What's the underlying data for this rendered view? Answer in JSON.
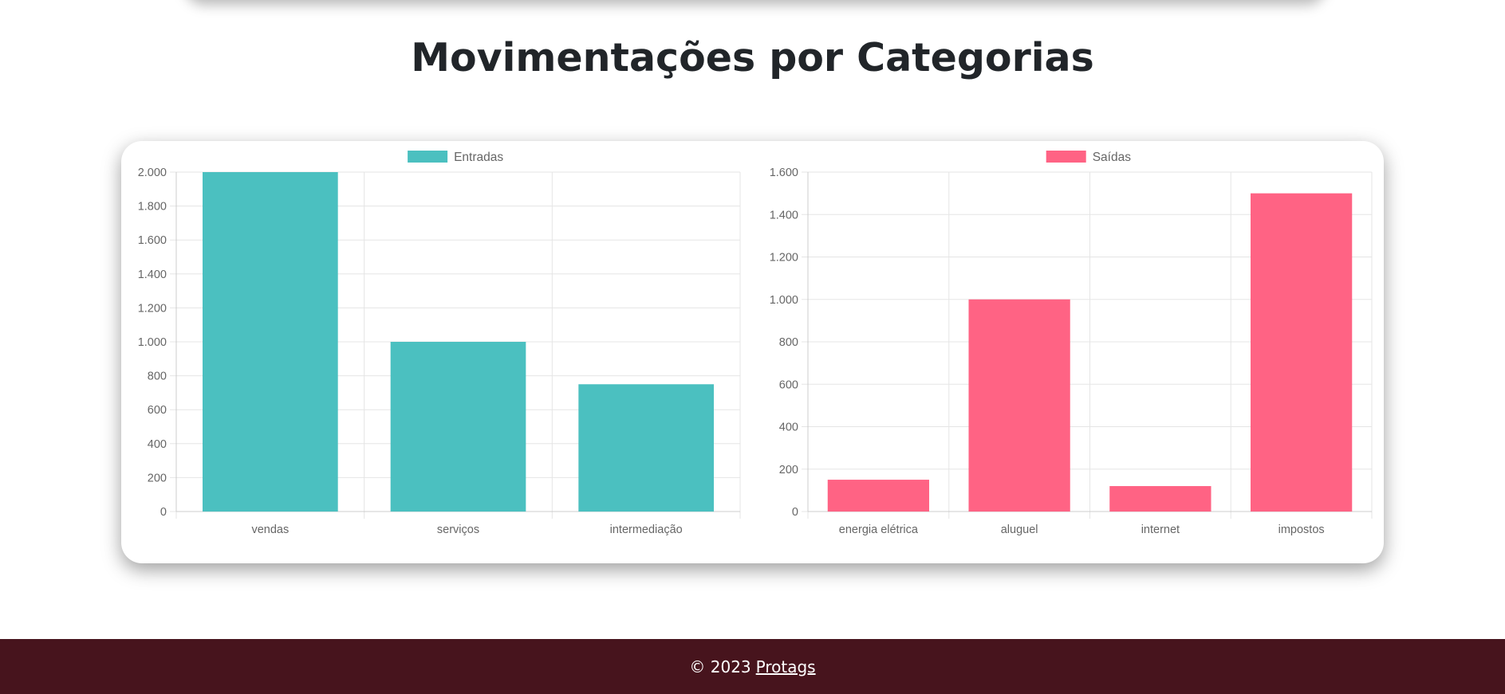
{
  "page": {
    "title": "Movimentações por Categorias"
  },
  "footer": {
    "copyright": "© 2023",
    "link_label": "Protags"
  },
  "colors": {
    "entradas": "#4bc0c0",
    "saidas": "#ff6384",
    "footer_bg": "#47141d",
    "grid": "#e5e5e5"
  },
  "chart_data": [
    {
      "type": "bar",
      "title": "",
      "legend": {
        "label": "Entradas",
        "position": "top"
      },
      "categories": [
        "vendas",
        "serviços",
        "intermediação"
      ],
      "series": [
        {
          "name": "Entradas",
          "values": [
            2000,
            1000,
            750
          ]
        }
      ],
      "ylim": [
        0,
        2000
      ],
      "yticks": [
        0,
        200,
        400,
        600,
        800,
        1000,
        1200,
        1400,
        1600,
        1800,
        2000
      ],
      "ytick_labels": [
        "0",
        "200",
        "400",
        "600",
        "800",
        "1.000",
        "1.200",
        "1.400",
        "1.600",
        "1.800",
        "2.000"
      ],
      "grid": true,
      "color": "#4bc0c0"
    },
    {
      "type": "bar",
      "title": "",
      "legend": {
        "label": "Saídas",
        "position": "top"
      },
      "categories": [
        "energia elétrica",
        "aluguel",
        "internet",
        "impostos"
      ],
      "series": [
        {
          "name": "Saídas",
          "values": [
            150,
            1000,
            120,
            1500
          ]
        }
      ],
      "ylim": [
        0,
        1600
      ],
      "yticks": [
        0,
        200,
        400,
        600,
        800,
        1000,
        1200,
        1400,
        1600
      ],
      "ytick_labels": [
        "0",
        "200",
        "400",
        "600",
        "800",
        "1.000",
        "1.200",
        "1.400",
        "1.600"
      ],
      "grid": true,
      "color": "#ff6384"
    }
  ]
}
